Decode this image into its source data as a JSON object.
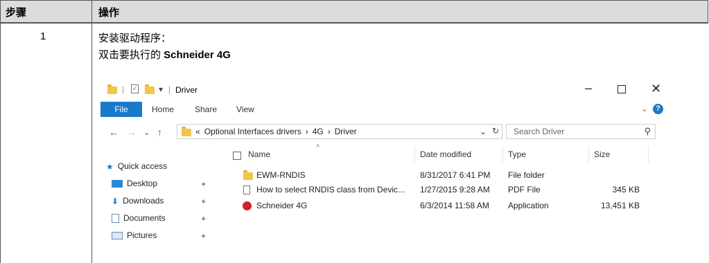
{
  "table": {
    "header_step": "步骤",
    "header_action": "操作",
    "step_number": "1",
    "action_line1": "安装驱动程序：",
    "action_line2_prefix": "双击要执行的 ",
    "action_line2_bold": "Schneider 4G"
  },
  "explorer": {
    "title": "Driver",
    "ribbon_tabs": [
      "File",
      "Home",
      "Share",
      "View"
    ],
    "breadcrumb": [
      "«",
      "Optional Interfaces drivers",
      "›",
      "4G",
      "›",
      "Driver"
    ],
    "search_placeholder": "Search Driver",
    "nav_items": [
      {
        "label": "Quick access",
        "icon": "star-icon",
        "pinned": false
      },
      {
        "label": "Desktop",
        "icon": "desktop-icon",
        "pinned": true
      },
      {
        "label": "Downloads",
        "icon": "download-icon",
        "pinned": true
      },
      {
        "label": "Documents",
        "icon": "documents-icon",
        "pinned": true
      },
      {
        "label": "Pictures",
        "icon": "pictures-icon",
        "pinned": true
      }
    ],
    "columns": [
      "Name",
      "Date modified",
      "Type",
      "Size"
    ],
    "files": [
      {
        "name": "EWM-RNDIS",
        "date": "8/31/2017 6:41 PM",
        "type": "File folder",
        "size": "",
        "icon": "folder-icon"
      },
      {
        "name": "How to select RNDIS class from Devic...",
        "date": "1/27/2015 9:28 AM",
        "type": "PDF File",
        "size": "345 KB",
        "icon": "pdf-file-icon"
      },
      {
        "name": "Schneider 4G",
        "date": "6/3/2014 11:58 AM",
        "type": "Application",
        "size": "13,451 KB",
        "icon": "application-icon"
      }
    ],
    "colors": {
      "accent": "#1979ca",
      "folder": "#f3c64b",
      "app": "#d0202a"
    }
  }
}
